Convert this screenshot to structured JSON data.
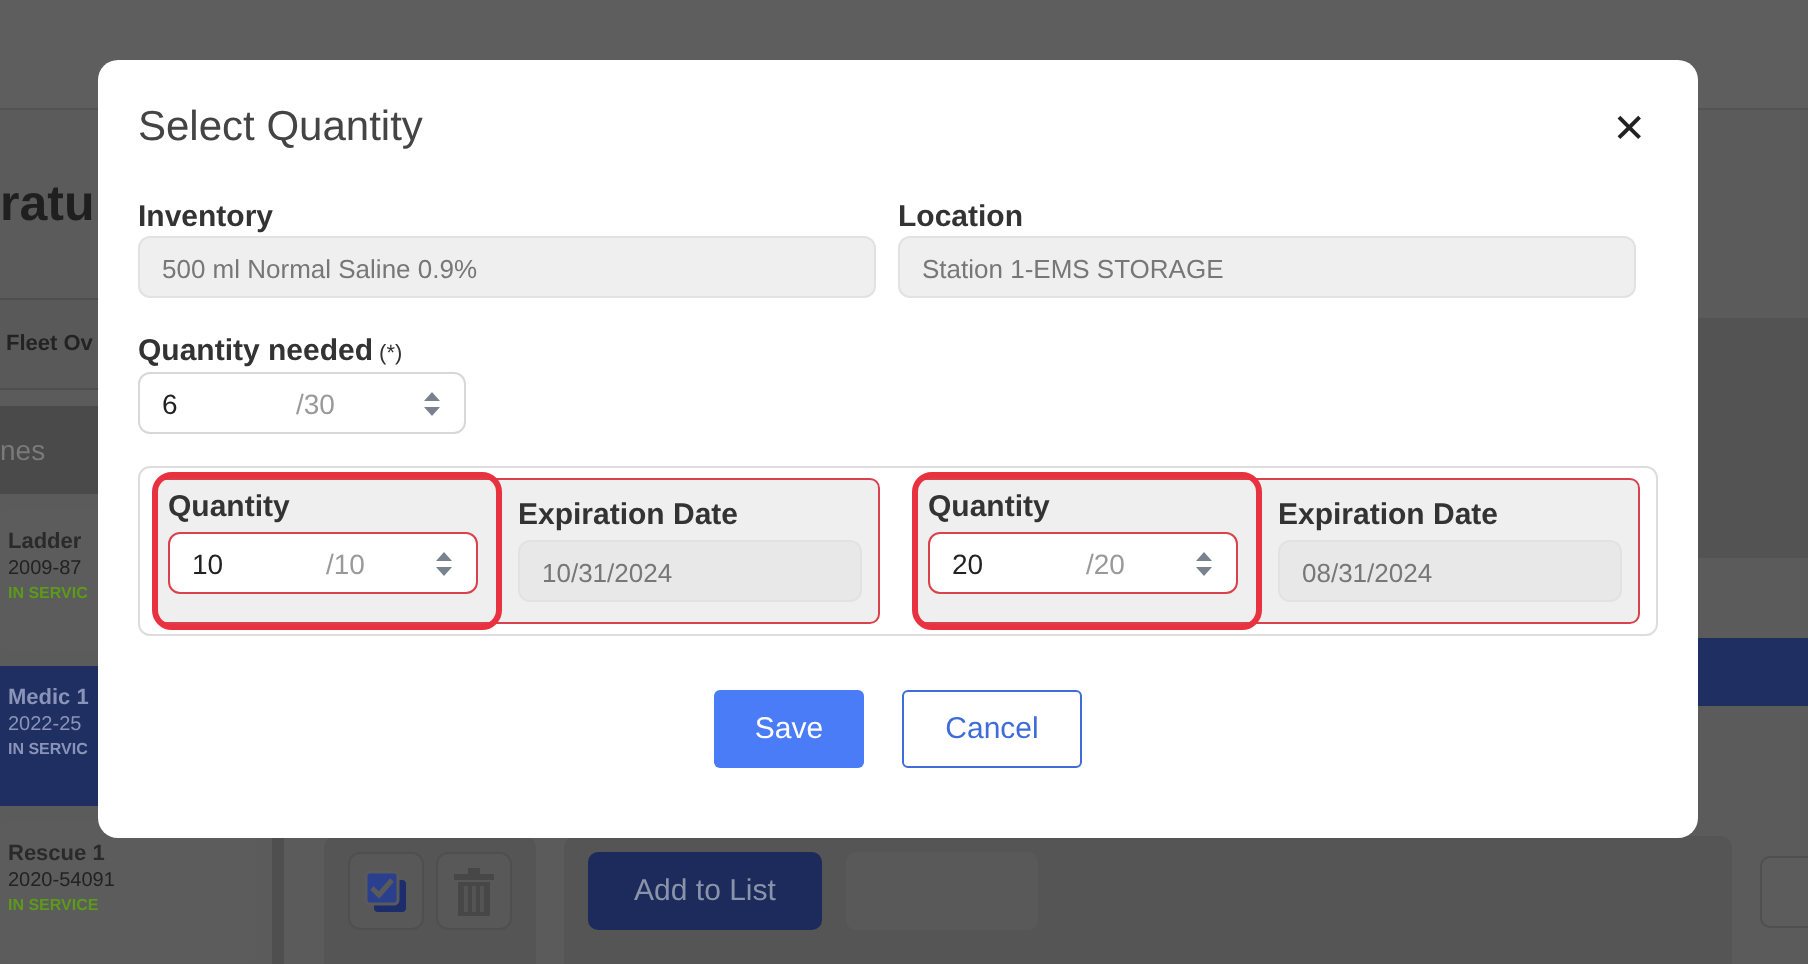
{
  "background": {
    "page_title": "ratu",
    "tab": "Fleet Ov",
    "filter": "nes",
    "units": [
      {
        "name": "Ladder",
        "number": "2009-87",
        "status": "IN SERVIC",
        "selected": false
      },
      {
        "name": "Medic 1",
        "number": "2022-25",
        "status": "IN SERVIC",
        "selected": true
      },
      {
        "name": "Rescue 1",
        "number": "2020-54091",
        "status": "IN SERVICE",
        "selected": false
      }
    ],
    "add_button": "Add to List"
  },
  "dialog": {
    "title": "Select Quantity",
    "close": "✕",
    "inventory": {
      "label": "Inventory",
      "value": "500 ml Normal Saline 0.9%"
    },
    "location": {
      "label": "Location",
      "value": "Station 1-EMS STORAGE"
    },
    "quantity_needed": {
      "label": "Quantity needed",
      "required_mark": "(*)",
      "value": "6",
      "max": "/30"
    },
    "lots": [
      {
        "quantity_label": "Quantity",
        "quantity": "10",
        "max": "/10",
        "expiration_label": "Expiration Date",
        "expiration": "10/31/2024",
        "highlighted": true
      },
      {
        "quantity_label": "Quantity",
        "quantity": "20",
        "max": "/20",
        "expiration_label": "Expiration Date",
        "expiration": "08/31/2024",
        "highlighted": true
      }
    ],
    "buttons": [
      {
        "label": "Save",
        "kind": "primary"
      },
      {
        "label": "Cancel",
        "kind": "secondary"
      }
    ]
  }
}
